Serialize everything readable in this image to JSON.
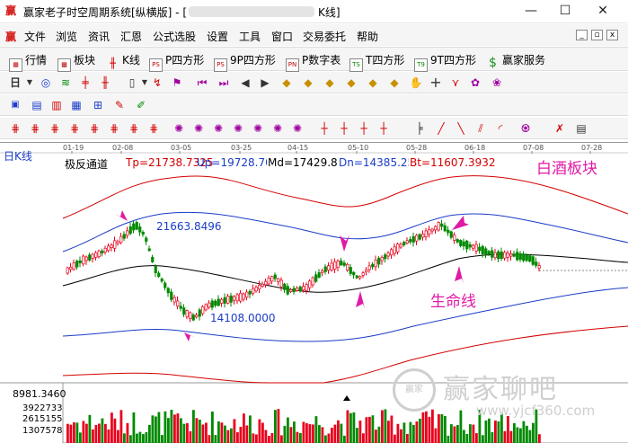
{
  "window": {
    "title_prefix": "赢家老子时空周期系统[纵横版] - [",
    "title_suffix": "K线]",
    "minimize": "—",
    "maximize": "☐",
    "close": "✕"
  },
  "menu": {
    "items": [
      "文件",
      "浏览",
      "资讯",
      "汇恩",
      "公式选股",
      "设置",
      "工具",
      "窗口",
      "交易委托",
      "帮助"
    ],
    "mdi_min": "_",
    "mdi_restore": "▫",
    "mdi_close": "x"
  },
  "toolbar1": {
    "items": [
      "行情",
      "板块",
      "K线",
      "P四方形",
      "9P四方形",
      "P数字表",
      "T四方形",
      "9T四方形",
      "赢家服务"
    ],
    "icons": [
      "PS",
      "PS",
      "PN",
      "TS",
      "T9"
    ]
  },
  "toolbar2": {
    "period": "日"
  },
  "chart": {
    "period_label": "日K线",
    "indicator": {
      "name": "极反通道",
      "tp": "Tp=21738.7325",
      "up": "Up=19728.7039",
      "md": "Md=17429.8370",
      "dn": "Dn=14385.2526",
      "bt": "Bt=11607.3932"
    },
    "sector_label": "白酒板块",
    "dates": [
      "01-19",
      "02-08",
      "03-05",
      "03-25",
      "04-15",
      "05-10",
      "05-28",
      "06-18",
      "07-08",
      "07-28"
    ],
    "high_label": "21663.8496",
    "low_label": "14108.0000",
    "lifeline_label": "生命线",
    "volume": {
      "top": "8981.3460",
      "l1": "3922733",
      "l2": "2615155",
      "l3": "1307578"
    },
    "colors": {
      "up_candle": "#e8001c",
      "down_candle": "#008a00",
      "tp_band": "#d40000",
      "up_band": "#1a3cc8",
      "md_band": "#000000",
      "arrow": "#e01aa6"
    }
  },
  "watermark": {
    "logo": "赢家",
    "name": "赢家聊吧",
    "url": "www.yjcf360.com"
  }
}
